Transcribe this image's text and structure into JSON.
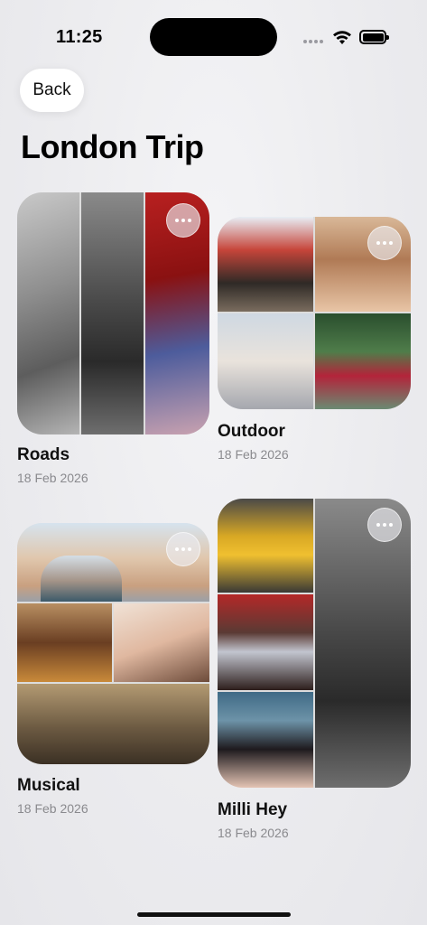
{
  "status_bar": {
    "time": "11:25"
  },
  "nav": {
    "back_label": "Back"
  },
  "page": {
    "title": "London Trip"
  },
  "albums": [
    {
      "name": "Roads",
      "date": "18 Feb 2026"
    },
    {
      "name": "Outdoor",
      "date": "18 Feb 2026"
    },
    {
      "name": "Musical",
      "date": "18 Feb 2026"
    },
    {
      "name": "Milli Hey",
      "date": "18 Feb 2026"
    }
  ],
  "icons": [
    "wifi-icon",
    "battery-icon",
    "more-icon"
  ]
}
